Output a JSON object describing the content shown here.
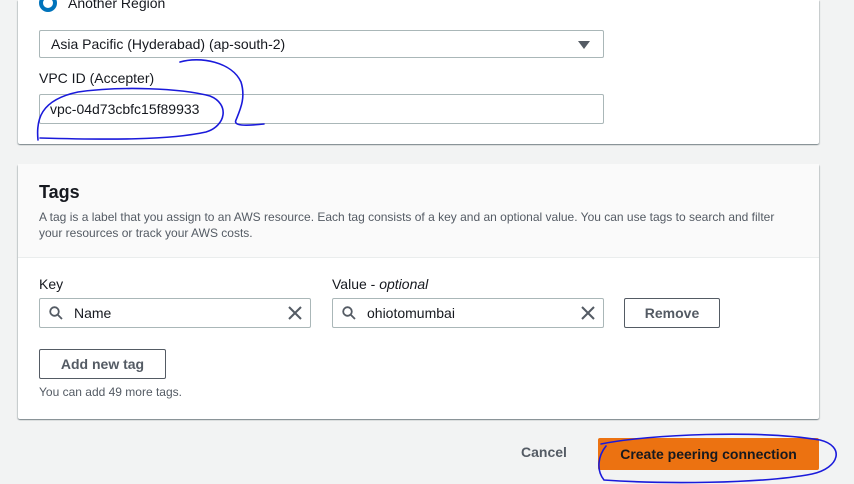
{
  "peering": {
    "region_option_label": "Another Region",
    "region_select_value": "Asia Pacific (Hyderabad) (ap-south-2)",
    "vpc_label": "VPC ID (Accepter)",
    "vpc_value": "vpc-04d73cbfc15f89933"
  },
  "tags": {
    "title": "Tags",
    "description": "A tag is a label that you assign to an AWS resource. Each tag consists of a key and an optional value. You can use tags to search and filter your resources or track your AWS costs.",
    "key_label": "Key",
    "value_label": "Value - ",
    "value_optional": "optional",
    "rows": [
      {
        "key": "Name",
        "value": "ohiotomumbai"
      }
    ],
    "remove_label": "Remove",
    "add_label": "Add new tag",
    "hint": "You can add 49 more tags."
  },
  "footer": {
    "cancel_label": "Cancel",
    "create_label": "Create peering connection"
  },
  "colors": {
    "primary": "#ec7211",
    "radio": "#0073bb",
    "annotation_ink": "#1a1adb"
  },
  "icons": [
    "radio-selected-icon",
    "caret-down-icon",
    "search-icon",
    "clear-icon"
  ]
}
